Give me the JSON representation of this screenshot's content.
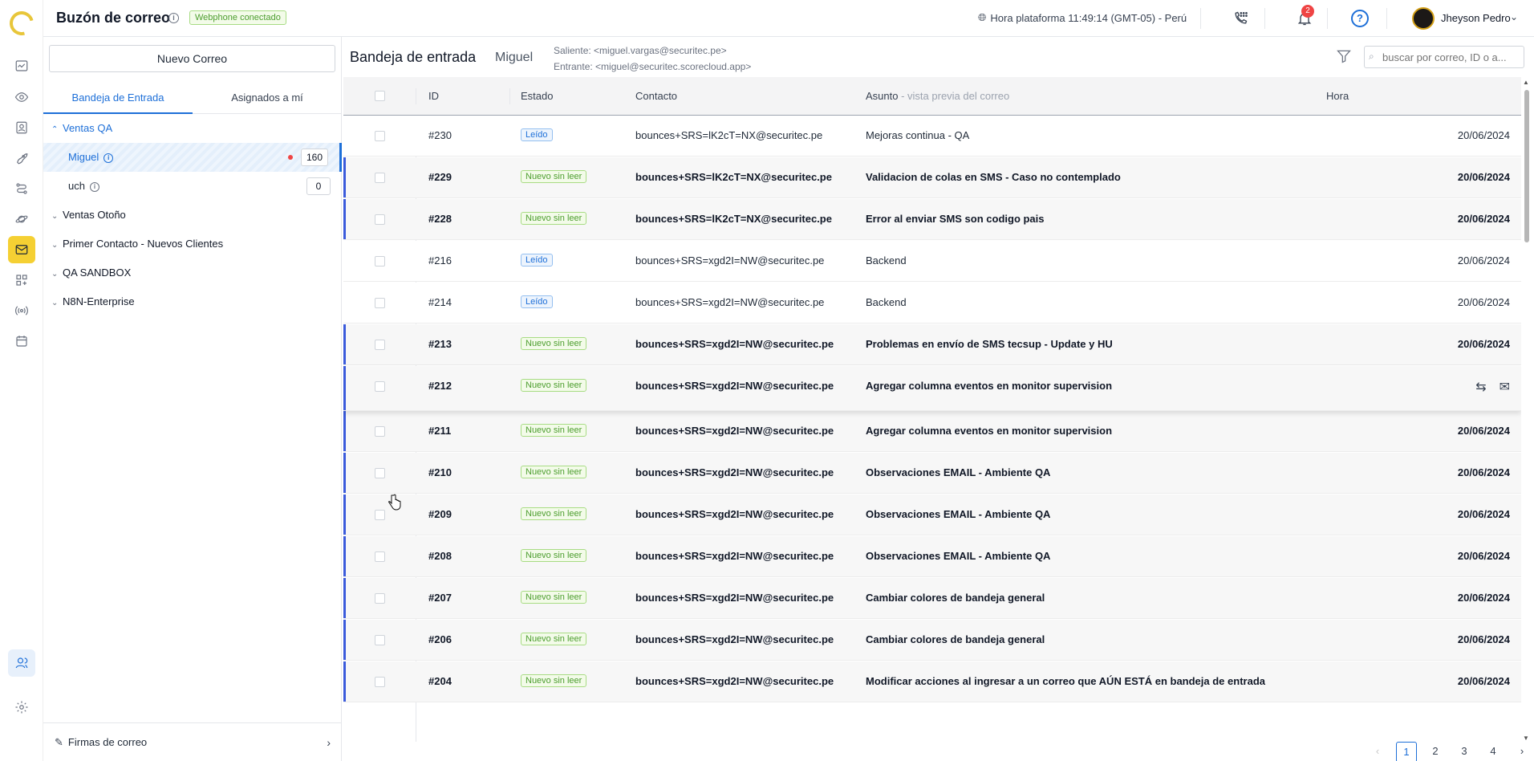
{
  "header": {
    "title": "Buzón de correo",
    "status_badge": "Webphone conectado",
    "clock": "Hora plataforma 11:49:14 (GMT-05) - Perú",
    "notification_count": "2",
    "help": "?",
    "user_name": "Jheyson Pedro"
  },
  "sidebar": {
    "new_mail": "Nuevo Correo",
    "tabs": [
      "Bandeja de Entrada",
      "Asignados a mí"
    ],
    "groups": [
      {
        "label": "Ventas QA",
        "open": true
      },
      {
        "label": "Ventas Otoño"
      },
      {
        "label": "Primer Contacto - Nuevos Clientes"
      },
      {
        "label": "QA SANDBOX"
      },
      {
        "label": "N8N-Enterprise"
      }
    ],
    "subitems": [
      {
        "label": "Miguel",
        "count": "160"
      },
      {
        "label": "uch",
        "count": "0"
      }
    ],
    "footer": "Firmas de correo"
  },
  "main": {
    "title": "Bandeja de entrada",
    "mailbox": "Miguel",
    "outgoing": "Saliente: <miguel.vargas@securitec.pe>",
    "incoming": "Entrante: <miguel@securitec.scorecloud.app>",
    "search_placeholder": "buscar por correo, ID o a...",
    "columns": {
      "id": "ID",
      "status": "Estado",
      "contact": "Contacto",
      "subject": "Asunto",
      "subject_hint": " - vista previa del correo",
      "time": "Hora"
    },
    "rows": [
      {
        "id": "#230",
        "status": "Leído",
        "contact": "bounces+SRS=lK2cT=NX@securitec.pe",
        "subject": "Mejoras continua - QA",
        "date": "20/06/2024"
      },
      {
        "id": "#229",
        "status": "Nuevo sin leer",
        "contact": "bounces+SRS=lK2cT=NX@securitec.pe",
        "subject": "Validacion de colas en SMS - Caso no contemplado",
        "date": "20/06/2024"
      },
      {
        "id": "#228",
        "status": "Nuevo sin leer",
        "contact": "bounces+SRS=lK2cT=NX@securitec.pe",
        "subject": "Error al enviar SMS son codigo pais",
        "date": "20/06/2024"
      },
      {
        "id": "#216",
        "status": "Leído",
        "contact": "bounces+SRS=xgd2I=NW@securitec.pe",
        "subject": "Backend",
        "date": "20/06/2024"
      },
      {
        "id": "#214",
        "status": "Leído",
        "contact": "bounces+SRS=xgd2I=NW@securitec.pe",
        "subject": "Backend",
        "date": "20/06/2024"
      },
      {
        "id": "#213",
        "status": "Nuevo sin leer",
        "contact": "bounces+SRS=xgd2I=NW@securitec.pe",
        "subject": "Problemas en envío de SMS tecsup - Update y HU",
        "date": "20/06/2024"
      },
      {
        "id": "#212",
        "status": "Nuevo sin leer",
        "contact": "bounces+SRS=xgd2I=NW@securitec.pe",
        "subject": "Agregar columna eventos en monitor supervision",
        "date": ""
      },
      {
        "id": "#211",
        "status": "Nuevo sin leer",
        "contact": "bounces+SRS=xgd2I=NW@securitec.pe",
        "subject": "Agregar columna eventos en monitor supervision",
        "date": "20/06/2024"
      },
      {
        "id": "#210",
        "status": "Nuevo sin leer",
        "contact": "bounces+SRS=xgd2I=NW@securitec.pe",
        "subject": "Observaciones EMAIL - Ambiente QA",
        "date": "20/06/2024"
      },
      {
        "id": "#209",
        "status": "Nuevo sin leer",
        "contact": "bounces+SRS=xgd2I=NW@securitec.pe",
        "subject": "Observaciones EMAIL - Ambiente QA",
        "date": "20/06/2024"
      },
      {
        "id": "#208",
        "status": "Nuevo sin leer",
        "contact": "bounces+SRS=xgd2I=NW@securitec.pe",
        "subject": "Observaciones EMAIL - Ambiente QA",
        "date": "20/06/2024"
      },
      {
        "id": "#207",
        "status": "Nuevo sin leer",
        "contact": "bounces+SRS=xgd2I=NW@securitec.pe",
        "subject": "Cambiar colores de bandeja general",
        "date": "20/06/2024"
      },
      {
        "id": "#206",
        "status": "Nuevo sin leer",
        "contact": "bounces+SRS=xgd2I=NW@securitec.pe",
        "subject": "Cambiar colores de bandeja general",
        "date": "20/06/2024"
      },
      {
        "id": "#204",
        "status": "Nuevo sin leer",
        "contact": "bounces+SRS=xgd2I=NW@securitec.pe",
        "subject": "Modificar acciones al ingresar a un correo que AÚN ESTÁ en bandeja de entrada",
        "date": "20/06/2024"
      }
    ],
    "pagination": {
      "prev": "‹",
      "pages": [
        "1",
        "2",
        "3",
        "4"
      ],
      "next": "›",
      "current": "1"
    }
  }
}
